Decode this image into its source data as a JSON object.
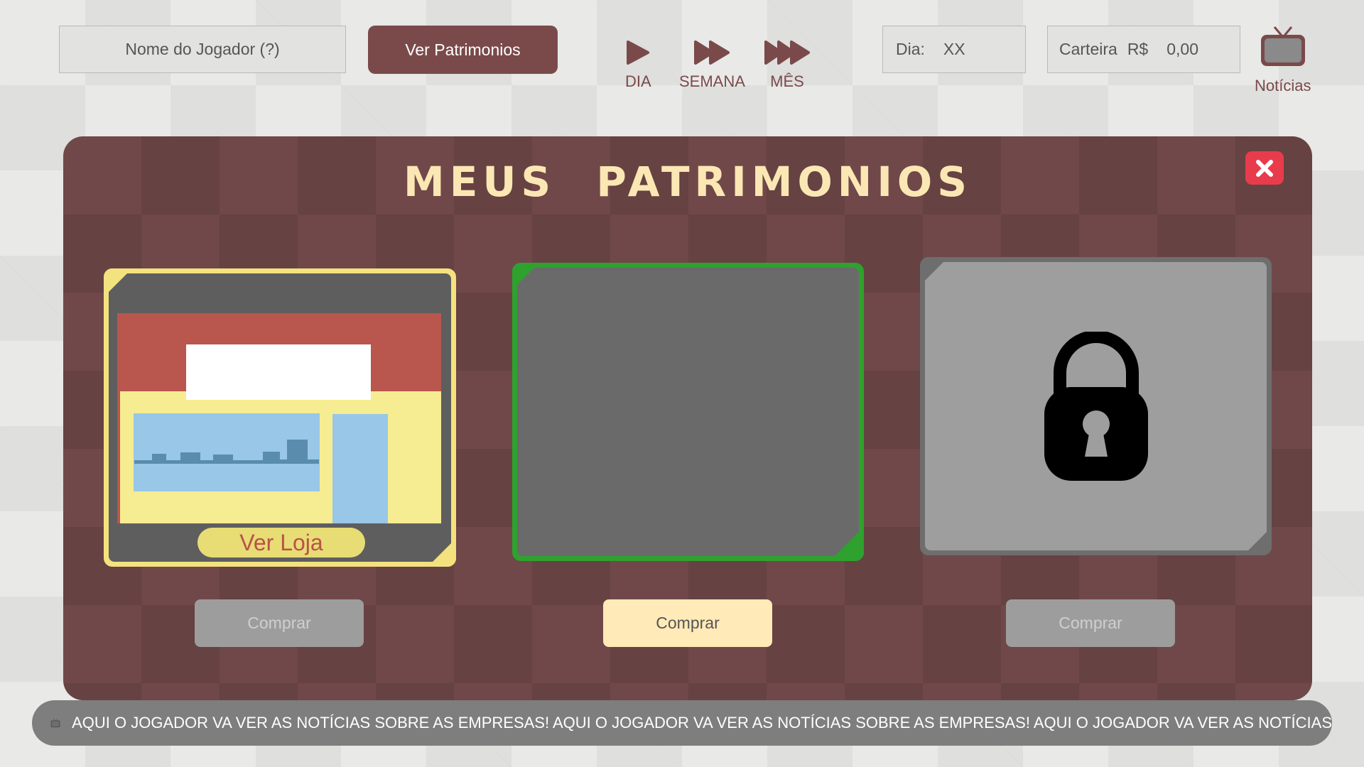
{
  "topbar": {
    "player_name": "Nome do Jogador (?)",
    "patrimonios_label": "Ver Patrimonios",
    "speed": {
      "day": "DIA",
      "week": "SEMANA",
      "month": "MÊS"
    },
    "day_label": "Dia:",
    "day_value": "XX",
    "wallet_label": "Carteira",
    "wallet_currency": "R$",
    "wallet_value": "0,00",
    "news_label": "Notícias"
  },
  "modal": {
    "title": "MEUS PATRIMONIOS",
    "cards": [
      {
        "state": "owned",
        "action_label": "Ver Loja",
        "buy_label": "Comprar",
        "buy_enabled": false
      },
      {
        "state": "available",
        "buy_label": "Comprar",
        "buy_enabled": true
      },
      {
        "state": "locked",
        "buy_label": "Comprar",
        "buy_enabled": false
      }
    ]
  },
  "ticker": {
    "text": "AQUI O JOGADOR VA VER AS NOTÍCIAS SOBRE AS EMPRESAS! AQUI O JOGADOR VA VER AS NOTÍCIAS SOBRE AS EMPRESAS! AQUI O JOGADOR VA VER AS NOTÍCIAS"
  },
  "colors": {
    "accent": "#7a4a4b",
    "title": "#fbe7b4",
    "close": "#e83c4c",
    "owned_border": "#f4e27e",
    "available_border": "#2ea12e",
    "locked_border": "#6e6e6e"
  },
  "icons": [
    "play-icon",
    "fast-forward-icon",
    "triple-forward-icon",
    "tv-icon",
    "close-icon",
    "lock-icon",
    "store-icon"
  ]
}
